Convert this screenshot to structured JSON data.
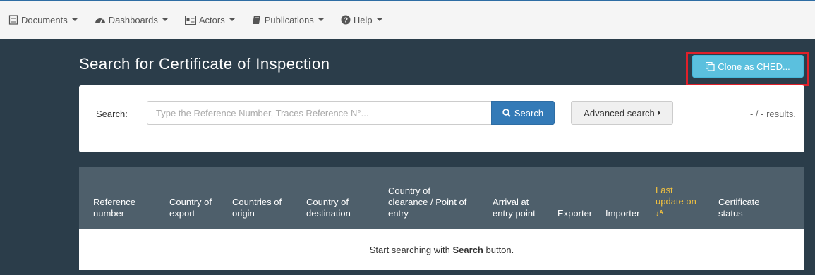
{
  "nav": {
    "items": [
      {
        "label": "Documents",
        "icon": "document-icon"
      },
      {
        "label": "Dashboards",
        "icon": "dashboard-icon"
      },
      {
        "label": "Actors",
        "icon": "id-card-icon"
      },
      {
        "label": "Publications",
        "icon": "book-icon"
      },
      {
        "label": "Help",
        "icon": "help-icon"
      }
    ]
  },
  "page": {
    "title": "Search for Certificate of Inspection",
    "clone_label": "Clone as CHED..."
  },
  "search": {
    "label": "Search:",
    "placeholder": "Type the Reference Number, Traces Reference N°...",
    "value": "",
    "button_label": "Search",
    "advanced_label": "Advanced search",
    "results_text": "- / - results."
  },
  "table": {
    "columns": [
      {
        "line1": "",
        "line2": "Reference",
        "line3": "number"
      },
      {
        "line1": "",
        "line2": "Country of",
        "line3": "export"
      },
      {
        "line1": "",
        "line2": "Countries of",
        "line3": "origin"
      },
      {
        "line1": "",
        "line2": "Country of",
        "line3": "destination"
      },
      {
        "line1": "Country of",
        "line2": "clearance / Point of",
        "line3": "entry"
      },
      {
        "line1": "",
        "line2": "Arrival at",
        "line3": "entry point"
      },
      {
        "line1": "",
        "line2": "",
        "line3": "Exporter"
      },
      {
        "line1": "",
        "line2": "",
        "line3": "Importer"
      },
      {
        "line1": "Last",
        "line2": "update on",
        "line3": ""
      },
      {
        "line1": "",
        "line2": "Certificate",
        "line3": "status"
      }
    ],
    "empty_prefix": "Start searching with ",
    "empty_bold": "Search",
    "empty_suffix": " button."
  },
  "colors": {
    "background": "#2b3d4a",
    "primary": "#337ab7",
    "info": "#5bc0de",
    "highlight": "#e0202a",
    "sort_active": "#f0c040"
  }
}
